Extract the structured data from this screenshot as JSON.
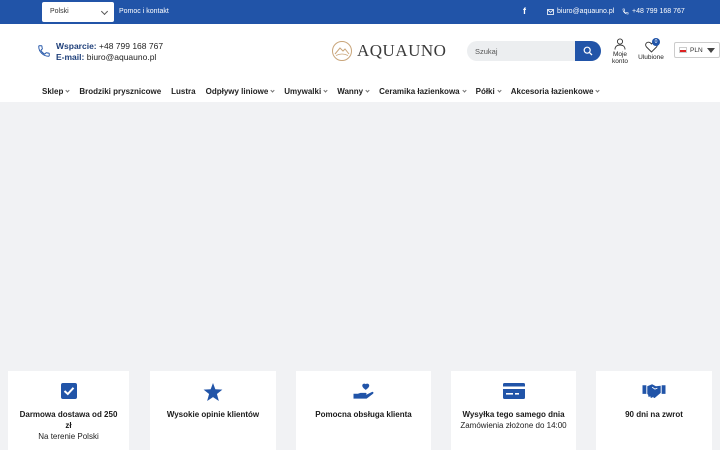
{
  "topbar": {
    "language": "Polski",
    "help_link": "Pomoc i kontakt",
    "facebook_icon": "f",
    "email": "biuro@aquauno.pl",
    "phone": "+48 799 168 767"
  },
  "header": {
    "support_label": "Wsparcie:",
    "support_phone": "+48 799 168 767",
    "email_label": "E-mail:",
    "email": "biuro@aquauno.pl",
    "logo_text": "AQUAUNO",
    "search_placeholder": "Szukaj",
    "account_line1": "Moje",
    "account_line2": "konto",
    "wishlist_label": "Ulubione",
    "wishlist_count": "0",
    "currency": "PLN"
  },
  "nav": [
    {
      "label": "Sklep",
      "has_dropdown": true
    },
    {
      "label": "Brodziki prysznicowe",
      "has_dropdown": false
    },
    {
      "label": "Lustra",
      "has_dropdown": false
    },
    {
      "label": "Odpływy liniowe",
      "has_dropdown": true
    },
    {
      "label": "Umywalki",
      "has_dropdown": true
    },
    {
      "label": "Wanny",
      "has_dropdown": true
    },
    {
      "label": "Ceramika łazienkowa",
      "has_dropdown": true
    },
    {
      "label": "Półki",
      "has_dropdown": true
    },
    {
      "label": "Akcesoria łazienkowe",
      "has_dropdown": true
    }
  ],
  "features": [
    {
      "icon": "checkbox-icon",
      "title": "Darmowa dostawa od 250 zł",
      "subtitle": "Na terenie Polski"
    },
    {
      "icon": "star-icon",
      "title": "Wysokie opinie klientów",
      "subtitle": ""
    },
    {
      "icon": "heart-hand-icon",
      "title": "Pomocna obsługa klienta",
      "subtitle": ""
    },
    {
      "icon": "card-icon",
      "title": "Wysyłka tego samego dnia",
      "subtitle": "Zamówienia złożone do 14:00"
    },
    {
      "icon": "handshake-icon",
      "title": "90 dni na zwrot",
      "subtitle": ""
    }
  ],
  "colors": {
    "brand_blue": "#2154a8",
    "page_bg": "#f1f2f4"
  }
}
